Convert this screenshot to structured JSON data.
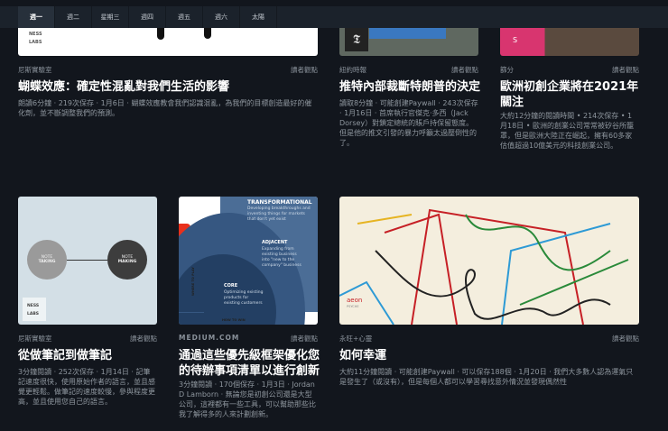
{
  "tabs": [
    "週一",
    "週二",
    "星期三",
    "週四",
    "週五",
    "週六",
    "太陽"
  ],
  "articles": [
    {
      "source": "尼斯實驗室",
      "badge": "讀者觀點",
      "title": "蝴蝶效應：確定性混亂對我們生活的影響",
      "desc": "朗讀6分鐘 · 219次保存 · 1月6日 · 蝴蝶效應教會我們認識混亂，為我們的目標創造最好的催化劑，並不斷調整我們的預測。",
      "image_text": [
        "NESS",
        "LABS"
      ]
    },
    {
      "source": "紐約時報",
      "badge": "讀者觀點",
      "title": "推特內部裁斷特朗普的決定",
      "desc": "讀取8分鐘 · 可能創建Paywall · 243次保存 · 1月16日 · 首席執行官傑克·多西（Jack Dorsey）對鎖定總統的賬戶持保留態度。但是他的推文引發的暴力呼籲太過壓倒性的了。",
      "image_text": [
        "𝕿"
      ]
    },
    {
      "source": "篩分",
      "badge": "讀者觀點",
      "title": "歐洲初創企業將在2021年關注",
      "desc": "大約12分鐘的閱讀時間 • 214次保存 • 1月18日 • 歐洲的創業公司常常被矽谷所籠罩，但是歐洲大陸正在崛起，擁有60多家估值超過10億美元的科技創業公司。",
      "image_text": [
        "S"
      ]
    },
    {
      "source": "尼斯實驗室",
      "badge": "讀者觀點",
      "title": "從做筆記到做筆記",
      "desc": "3分鐘閱讀 · 252次保存 · 1月14日 · 記筆記速度很快，使用原始作者的語言，並且感覺更輕鬆。做筆記的速度較慢，參與程度更高，並且使用您自己的語言。",
      "image_text": [
        "NOTE",
        "TAKING",
        "NOTE",
        "MAKING",
        "NESS",
        "LABS"
      ]
    },
    {
      "source": "MEDIUM.COM",
      "badge": "讀者觀點",
      "title": "通過這些優先級框架優化您的待辦事項清單以進行創新",
      "desc": "3分鐘閱讀 · 170個保存 · 1月3日 · Jordan D Lamborn · 無論您是初創公司還是大型公司，這裡都有一些工具，可以幫助那些比我了解得多的人來計劃創新。",
      "image_text": [
        "TRANSFORMATIONAL",
        "Developing breakthroughs and inventing things for markets that don't yet exist",
        "ADJACENT",
        "Expanding from existing business into \"new to the company\" business",
        "CORE",
        "Optimizing existing products for existing customers",
        "WHERE TO PLAY",
        "HOW TO WIN"
      ]
    },
    {
      "source": "永旺+心靈",
      "badge": "讀者觀點",
      "title": "如何幸運",
      "desc": "大約11分鐘閱讀 · 可能創建Paywall · 可以保存188個 · 1月20日 · 我們大多數人認為運氣只是發生了（或沒有），但是每個人都可以學習尋找意外情況並發現偶然性",
      "image_text": [
        "aeon",
        "PSYCHE"
      ]
    }
  ]
}
